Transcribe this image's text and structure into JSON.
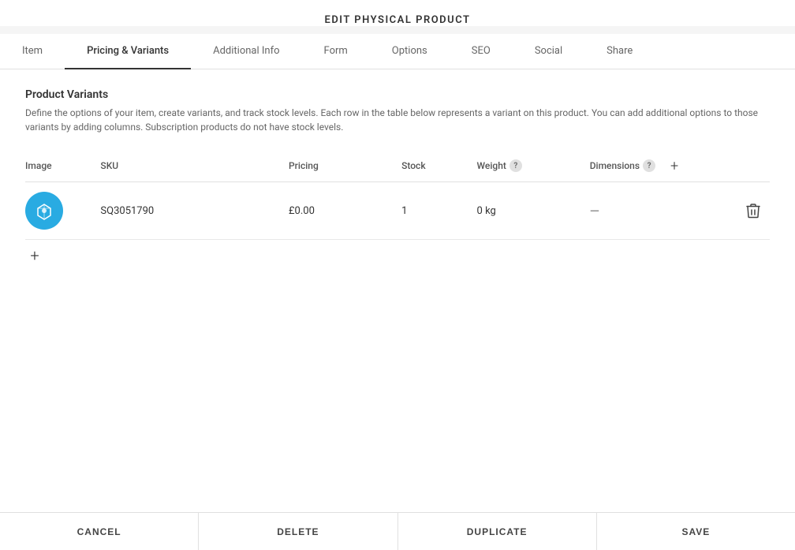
{
  "header": {
    "title": "EDIT PHYSICAL PRODUCT"
  },
  "tabs": [
    {
      "id": "item",
      "label": "Item",
      "active": false
    },
    {
      "id": "pricing-variants",
      "label": "Pricing & Variants",
      "active": true
    },
    {
      "id": "additional-info",
      "label": "Additional Info",
      "active": false
    },
    {
      "id": "form",
      "label": "Form",
      "active": false
    },
    {
      "id": "options",
      "label": "Options",
      "active": false
    },
    {
      "id": "seo",
      "label": "SEO",
      "active": false
    },
    {
      "id": "social",
      "label": "Social",
      "active": false
    },
    {
      "id": "share",
      "label": "Share",
      "active": false
    }
  ],
  "section": {
    "title": "Product Variants",
    "description": "Define the options of your item, create variants, and track stock levels. Each row in the table below represents a variant on this product. You can add additional options to those variants by adding columns. Subscription products do not have stock levels."
  },
  "table": {
    "columns": [
      {
        "id": "image",
        "label": "Image",
        "has_help": false
      },
      {
        "id": "sku",
        "label": "SKU",
        "has_help": false
      },
      {
        "id": "pricing",
        "label": "Pricing",
        "has_help": false
      },
      {
        "id": "stock",
        "label": "Stock",
        "has_help": false
      },
      {
        "id": "weight",
        "label": "Weight",
        "has_help": true
      },
      {
        "id": "dimensions",
        "label": "Dimensions",
        "has_help": true
      }
    ],
    "rows": [
      {
        "sku": "SQ3051790",
        "pricing": "£0.00",
        "stock": "1",
        "weight": "0 kg",
        "dimensions": "—"
      }
    ]
  },
  "footer": {
    "cancel_label": "CANCEL",
    "delete_label": "DELETE",
    "duplicate_label": "DUPLICATE",
    "save_label": "SAVE"
  },
  "icons": {
    "help": "?",
    "add": "+",
    "delete": "🗑",
    "add_row": "+"
  }
}
